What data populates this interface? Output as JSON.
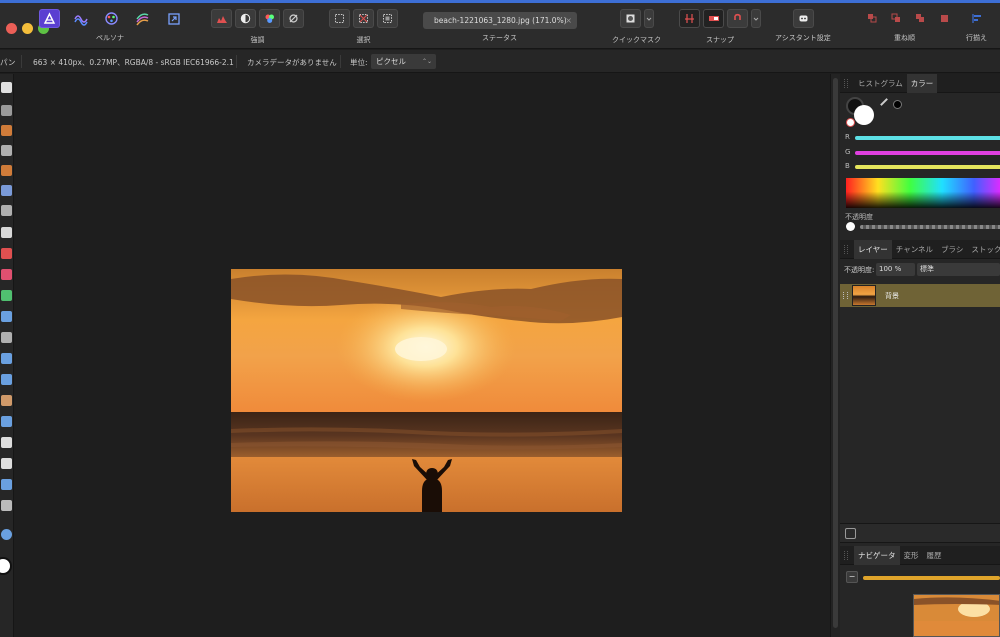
{
  "toolbar": {
    "persona_label": "ペルソナ",
    "adjust_label": "強調",
    "select_label": "選択",
    "status_label": "ステータス",
    "document_title": "beach-1221063_1280.jpg (171.0%)",
    "close_glyph": "×",
    "quickmask_label": "クイックマスク",
    "snap_label": "スナップ",
    "assistant_label": "アシスタント設定",
    "order_label": "重ね順",
    "align_label": "行揃え"
  },
  "context_bar": {
    "left_cut": "パン",
    "image_info": "663 × 410px、0.27MP、RGBA/8 - sRGB IEC61966-2.1",
    "camera_data": "カメラデータがありません",
    "unit_label": "単位:",
    "unit_value": "ピクセル",
    "unit_arrow": "⌃"
  },
  "color_panel": {
    "tabs": [
      "ヒストグラム",
      "カラー"
    ],
    "r_label": "R",
    "g_label": "G",
    "b_label": "B",
    "opacity_label": "不透明度",
    "colors": {
      "r": "#5de0e6",
      "g": "#e040e0",
      "b": "#e6e65d"
    }
  },
  "layers_panel": {
    "tabs": [
      "レイヤー",
      "チャンネル",
      "ブラシ",
      "ストック"
    ],
    "opacity_label": "不透明度:",
    "opacity_value": "100 %",
    "blend_mode": "標準",
    "layer_name": "背景"
  },
  "navigator_panel": {
    "tabs": [
      "ナビゲータ",
      "変形",
      "履歴"
    ],
    "zoom_out": "−"
  },
  "icons": [
    "persona-photo-icon",
    "persona-liquify-icon",
    "persona-develop-icon",
    "persona-tone-icon",
    "persona-export-icon"
  ],
  "accent": "#3d6fd6",
  "layer_highlight": "#6f6336"
}
